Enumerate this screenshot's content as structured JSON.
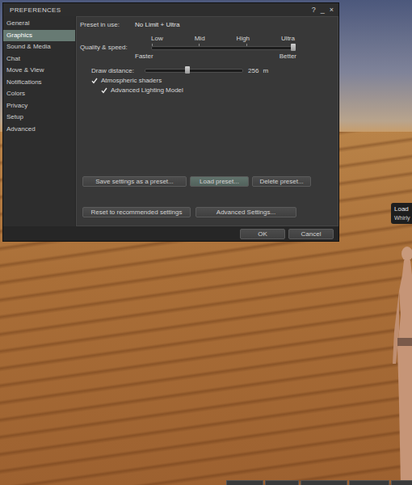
{
  "window": {
    "title": "PREFERENCES",
    "controls": [
      "?",
      "_",
      "×"
    ]
  },
  "sidebar": {
    "items": [
      {
        "label": "General",
        "selected": false
      },
      {
        "label": "Graphics",
        "selected": true
      },
      {
        "label": "Sound & Media",
        "selected": false
      },
      {
        "label": "Chat",
        "selected": false
      },
      {
        "label": "Move & View",
        "selected": false
      },
      {
        "label": "Notifications",
        "selected": false
      },
      {
        "label": "Colors",
        "selected": false
      },
      {
        "label": "Privacy",
        "selected": false
      },
      {
        "label": "Setup",
        "selected": false
      },
      {
        "label": "Advanced",
        "selected": false
      }
    ]
  },
  "preset": {
    "label": "Preset in use:",
    "value": "No Limit + Ultra"
  },
  "quality": {
    "label": "Quality & speed:",
    "ticks": [
      "Low",
      "Mid",
      "High",
      "Ultra"
    ],
    "left": "Faster",
    "right": "Better",
    "level": 1
  },
  "draw_distance": {
    "label": "Draw distance:",
    "level": 0.43,
    "reading": "256",
    "unit": "m"
  },
  "checkboxes": [
    {
      "label": "Atmospheric shaders",
      "checked": true,
      "nested": false
    },
    {
      "label": "Advanced Lighting Model",
      "checked": true,
      "nested": true
    }
  ],
  "preset_buttons": [
    {
      "label": "Save settings as a preset...",
      "highlighted": false
    },
    {
      "label": "Load preset...",
      "highlighted": true
    },
    {
      "label": "Delete preset...",
      "highlighted": false
    }
  ],
  "settings_buttons": [
    {
      "label": "Reset to recommended settings",
      "highlighted": false
    },
    {
      "label": "Advanced Settings...",
      "highlighted": false
    }
  ],
  "footer_buttons": [
    "OK",
    "Cancel"
  ],
  "tooltip": {
    "lines": [
      "Load",
      "Whirly"
    ]
  }
}
